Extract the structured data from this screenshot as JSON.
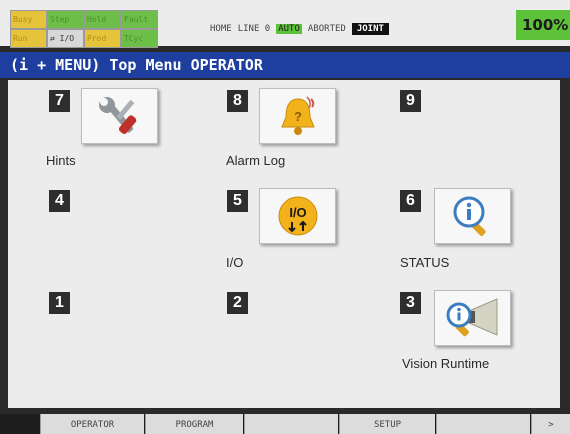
{
  "status_leds": {
    "busy": "Busy",
    "step": "Step",
    "hold": "Hold",
    "fault": "Fault",
    "run": "Run",
    "io": "I/O",
    "prod": "Prod",
    "tcyc": "TCyc"
  },
  "status_line": {
    "program": "HOME",
    "line": "LINE 0",
    "mode": "AUTO",
    "state": "ABORTED",
    "coord": "JOINT"
  },
  "override": "100%",
  "title": "(i + MENU) Top Menu OPERATOR",
  "menu": {
    "items": [
      {
        "number": "7",
        "label": "Hints",
        "icon": "tools-icon"
      },
      {
        "number": "8",
        "label": "Alarm Log",
        "icon": "alarm-bell-icon"
      },
      {
        "number": "9",
        "label": "",
        "icon": ""
      },
      {
        "number": "4",
        "label": "",
        "icon": ""
      },
      {
        "number": "5",
        "label": "I/O",
        "icon": "io-icon"
      },
      {
        "number": "6",
        "label": "STATUS",
        "icon": "status-info-icon"
      },
      {
        "number": "1",
        "label": "",
        "icon": ""
      },
      {
        "number": "2",
        "label": "",
        "icon": ""
      },
      {
        "number": "3",
        "label": "Vision Runtime",
        "icon": "vision-info-icon"
      }
    ]
  },
  "function_keys": {
    "f1": "OPERATOR",
    "f2": "PROGRAM",
    "f3": "",
    "f4": "SETUP",
    "f5": "",
    "next": ">"
  },
  "colors": {
    "title_bar": "#1e3fa0",
    "auto_badge": "#5ec13a",
    "tile_bg": "#f7f7f7"
  }
}
